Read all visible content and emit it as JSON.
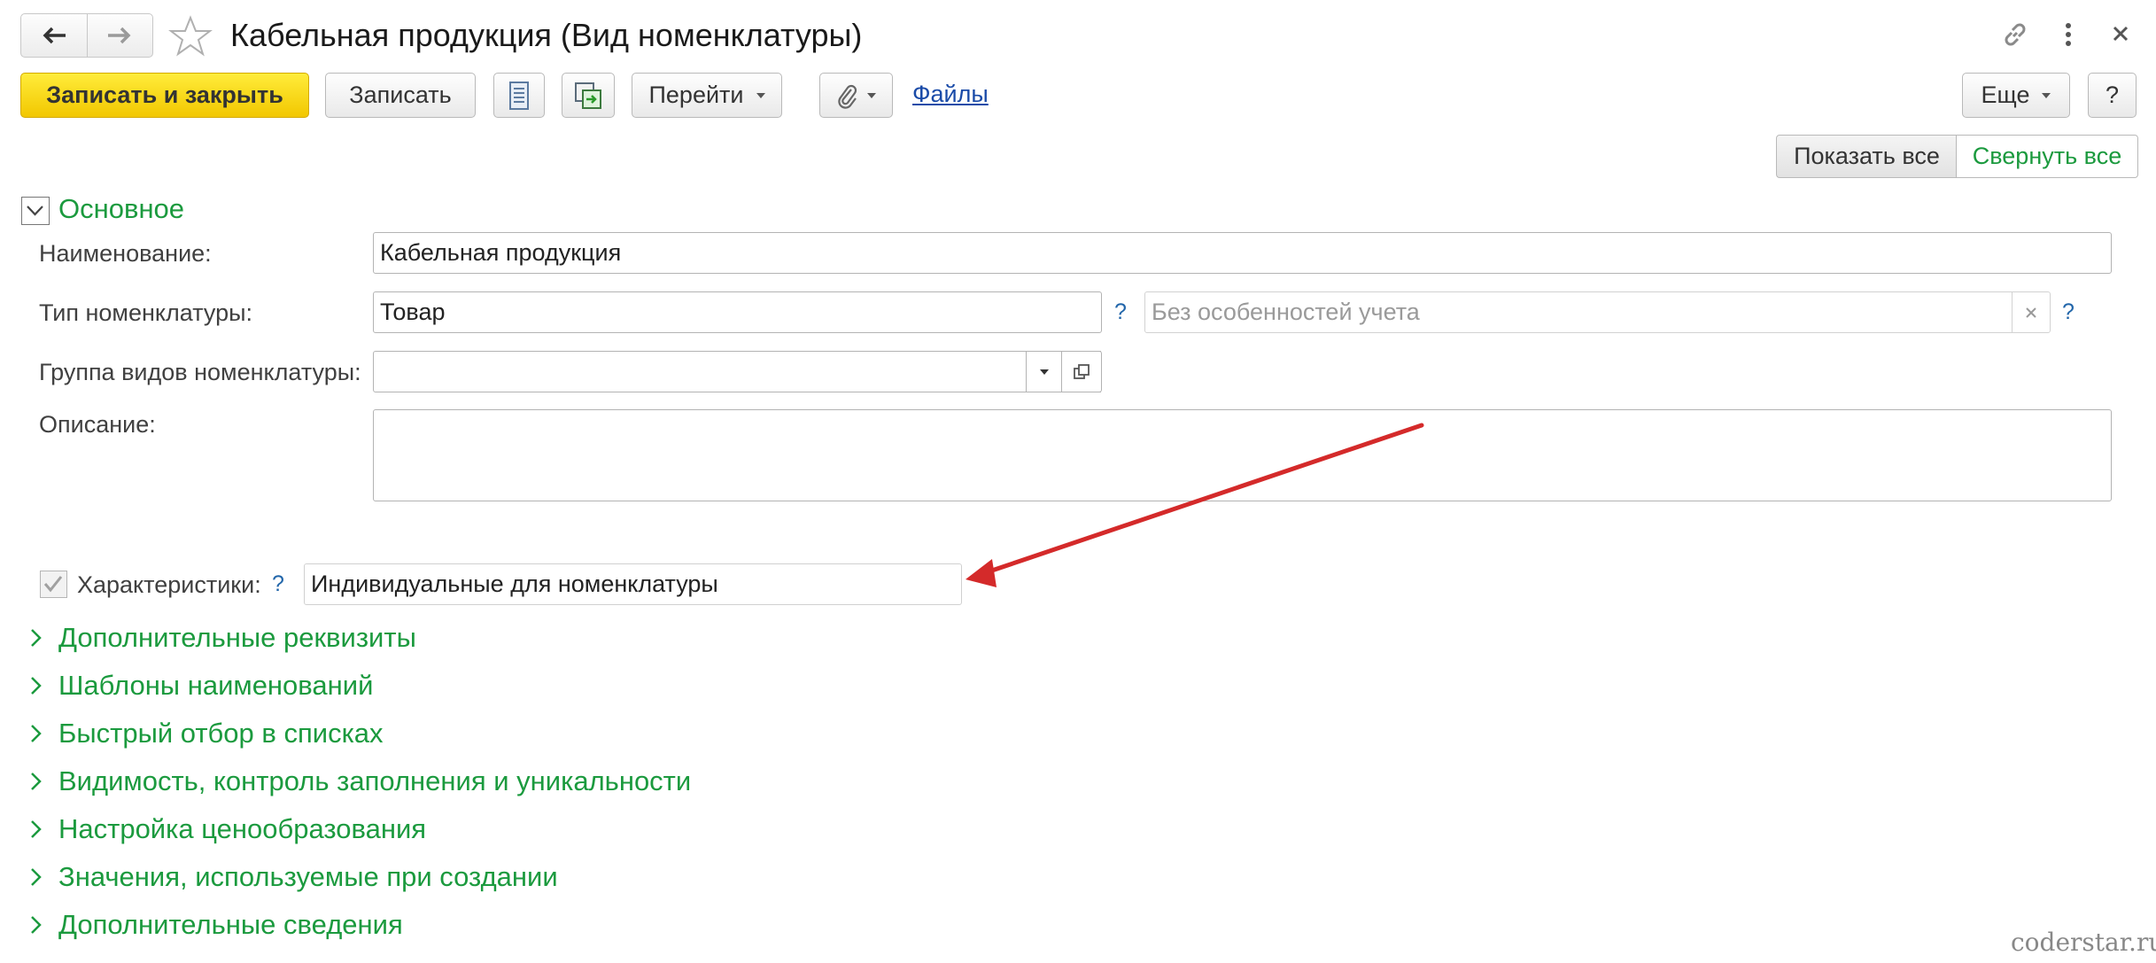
{
  "window": {
    "title": "Кабельная продукция (Вид номенклатуры)",
    "icons": [
      "back-arrow-icon",
      "forward-arrow-icon",
      "favorite-star-icon",
      "link-icon",
      "more-vertical-icon",
      "close-icon"
    ]
  },
  "toolbar": {
    "save_close": "Записать и закрыть",
    "save": "Записать",
    "goto": "Перейти",
    "files": "Файлы",
    "more": "Еще",
    "help": "?"
  },
  "panel": {
    "show_all": "Показать все",
    "collapse_all": "Свернуть все"
  },
  "main_group": {
    "title": "Основное",
    "name_label": "Наименование:",
    "name_value": "Кабельная продукция",
    "type_label": "Тип номенклатуры:",
    "type_value": "Товар",
    "type_help": "?",
    "accounting_placeholder": "Без особенностей учета",
    "accounting_help": "?",
    "group_label": "Группа видов номенклатуры:",
    "group_value": "",
    "description_label": "Описание:",
    "description_value": "",
    "characteristics_label": "Характеристики:",
    "characteristics_checked": true,
    "characteristics_help": "?",
    "characteristics_value": "Индивидуальные для номенклатуры"
  },
  "sections": [
    {
      "label": "Дополнительные реквизиты"
    },
    {
      "label": "Шаблоны наименований"
    },
    {
      "label": "Быстрый отбор в списках"
    },
    {
      "label": "Видимость, контроль заполнения и уникальности"
    },
    {
      "label": "Настройка ценообразования"
    },
    {
      "label": "Значения, используемые при создании"
    },
    {
      "label": "Дополнительные сведения"
    }
  ],
  "watermark": "coderstar.ru",
  "colors": {
    "accent_green": "#1b9a3e",
    "primary_button": "#f7d81b",
    "link_blue": "#1a4ba8",
    "arrow_red": "#d42a2a"
  }
}
